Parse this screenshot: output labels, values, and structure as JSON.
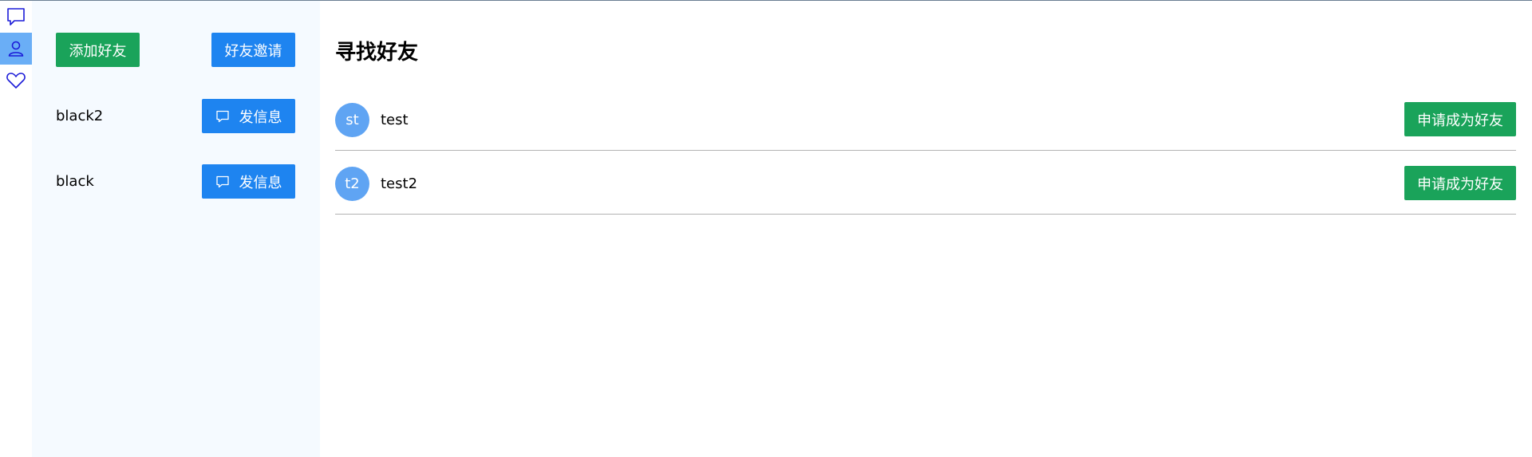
{
  "colors": {
    "rail_active": "#6aaef6",
    "panel_bg": "#f5faff",
    "green_button": "#1aa35a",
    "blue_button": "#1e84f0",
    "avatar_bg": "#5fa4f3",
    "icon_stroke": "#1b1bd8",
    "divider": "#b3b3b3"
  },
  "rail": {
    "items": [
      {
        "icon": "chat-bubble-icon",
        "active": false
      },
      {
        "icon": "user-icon",
        "active": true
      },
      {
        "icon": "heart-icon",
        "active": false
      }
    ]
  },
  "friends_panel": {
    "add_friend_label": "添加好友",
    "friend_invite_label": "好友邀请",
    "send_message_icon": "message-icon",
    "friends": [
      {
        "name": "black2",
        "action_label": "发信息"
      },
      {
        "name": "black",
        "action_label": "发信息"
      }
    ]
  },
  "main": {
    "title": "寻找好友",
    "users": [
      {
        "avatar_text": "st",
        "name": "test",
        "action_label": "申请成为好友"
      },
      {
        "avatar_text": "t2",
        "name": "test2",
        "action_label": "申请成为好友"
      }
    ]
  }
}
